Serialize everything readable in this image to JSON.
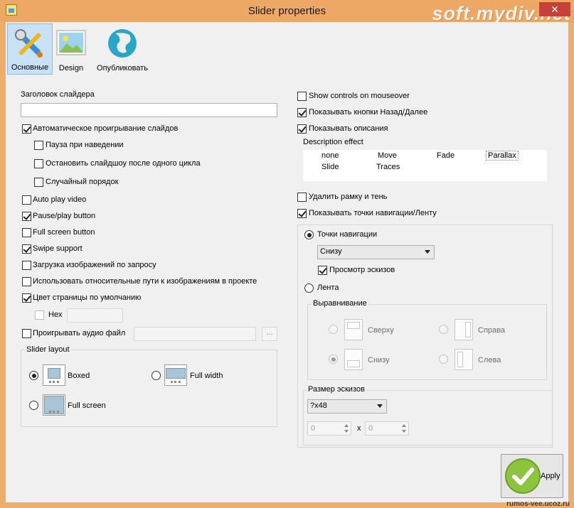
{
  "window": {
    "title": "Slider properties",
    "watermark": "soft.mydiv.net",
    "footer_watermark": "rumos-vee.ucoz.ru"
  },
  "toolbar": [
    {
      "label": "Основные",
      "icon": "wrench-screwdriver-icon",
      "active": true
    },
    {
      "label": "Design",
      "icon": "landscape-picture-icon",
      "active": false
    },
    {
      "label": "Опубликовать",
      "icon": "globe-icon",
      "active": false
    }
  ],
  "left": {
    "title_label": "Заголовок слайдера",
    "title_value": "",
    "autoplay": {
      "label": "Автоматическое проигрывание слайдов",
      "checked": true
    },
    "pause_hover": {
      "label": "Пауза при наведении",
      "checked": false
    },
    "stop_after_cycle": {
      "label": "Остановить слайдшоу после одного цикла",
      "checked": false
    },
    "random_order": {
      "label": "Случайный порядок",
      "checked": false
    },
    "auto_play_video": {
      "label": "Auto play video",
      "checked": false
    },
    "pause_play_button": {
      "label": "Pause/play button",
      "checked": true
    },
    "full_screen_button": {
      "label": "Full screen button",
      "checked": false
    },
    "swipe_support": {
      "label": "Swipe support",
      "checked": true
    },
    "lazy_load": {
      "label": "Загрузка изображений по запросу",
      "checked": false
    },
    "relative_paths": {
      "label": "Использовать относительные пути к изображениям в проекте",
      "checked": false
    },
    "page_color": {
      "label": "Цвет страницы по умолчанию",
      "checked": true
    },
    "hex": {
      "label": "Hex",
      "checked": false,
      "value": ""
    },
    "audio": {
      "label": "Проигрывать аудио файл",
      "checked": false,
      "value": "",
      "browse": "..."
    },
    "layout": {
      "title": "Slider layout",
      "boxed": {
        "label": "Boxed",
        "checked": true
      },
      "full_width": {
        "label": "Full width",
        "checked": false
      },
      "full_screen": {
        "label": "Full screen",
        "checked": false
      }
    }
  },
  "right": {
    "show_controls": {
      "label": "Show controls on mouseover",
      "checked": false
    },
    "show_prev_next": {
      "label": "Показывать кнопки Назад/Далее",
      "checked": true
    },
    "show_descriptions": {
      "label": "Показывать описания",
      "checked": true
    },
    "description_effect": {
      "label": "Description effect",
      "options": [
        "none",
        "Move",
        "Fade",
        "Parallax",
        "Slide",
        "Traces"
      ],
      "selected": "Parallax"
    },
    "remove_frame": {
      "label": "Удалить рамку и тень",
      "checked": false
    },
    "show_nav": {
      "label": "Показывать точки навигации/Ленту",
      "checked": true
    },
    "nav_points": {
      "label": "Точки навигации",
      "checked": true
    },
    "nav_position": "Снизу",
    "thumbs_preview": {
      "label": "Просмотр эскизов",
      "checked": true
    },
    "ribbon": {
      "label": "Лента",
      "checked": false
    },
    "alignment": {
      "title": "Выравнивание",
      "top": {
        "label": "Сверху",
        "checked": false
      },
      "right": {
        "label": "Справа",
        "checked": false
      },
      "bottom": {
        "label": "Снизу",
        "checked": true
      },
      "left": {
        "label": "Слева",
        "checked": false
      }
    },
    "thumb_size": {
      "title": "Размер эскизов",
      "value": "?x48",
      "width": "0",
      "height": "0",
      "x": "x"
    }
  },
  "apply": {
    "label": "Apply"
  }
}
